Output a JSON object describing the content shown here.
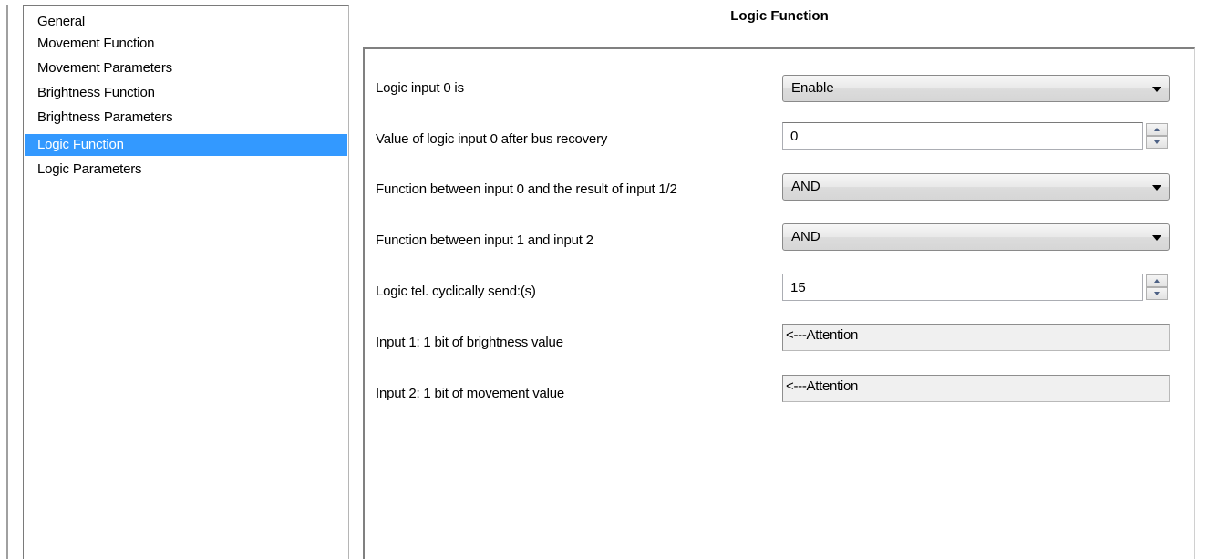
{
  "nav": {
    "items": [
      {
        "label": "General",
        "selected": false
      },
      {
        "label": "Movement Function",
        "selected": false
      },
      {
        "label": "Movement Parameters",
        "selected": false
      },
      {
        "label": "Brightness Function",
        "selected": false
      },
      {
        "label": "Brightness Parameters",
        "selected": false
      },
      {
        "label": "Logic Function",
        "selected": true
      },
      {
        "label": "Logic Parameters",
        "selected": false
      }
    ],
    "selected_color": "#3399ff"
  },
  "panel": {
    "title": "Logic Function",
    "params": [
      {
        "label": "Logic input 0 is",
        "control": "dropdown",
        "value": "Enable",
        "icon": "chevron-down-icon"
      },
      {
        "label": "Value of logic input 0 after bus recovery",
        "control": "spinbox",
        "value": "0",
        "icons": [
          "spin-up-icon",
          "spin-down-icon"
        ]
      },
      {
        "label": "Function between input 0 and the result of input 1/2",
        "control": "dropdown",
        "value": "AND",
        "icon": "chevron-down-icon"
      },
      {
        "label": "Function between input 1 and input 2",
        "control": "dropdown",
        "value": "AND",
        "icon": "chevron-down-icon"
      },
      {
        "label": "Logic tel. cyclically send:(s)",
        "control": "spinbox",
        "value": "15",
        "icons": [
          "spin-up-icon",
          "spin-down-icon"
        ]
      },
      {
        "label": "Input 1: 1 bit of brightness value",
        "control": "readonly",
        "value": "<---Attention"
      },
      {
        "label": "Input 2: 1 bit of movement value",
        "control": "readonly",
        "value": "<---Attention"
      }
    ]
  }
}
